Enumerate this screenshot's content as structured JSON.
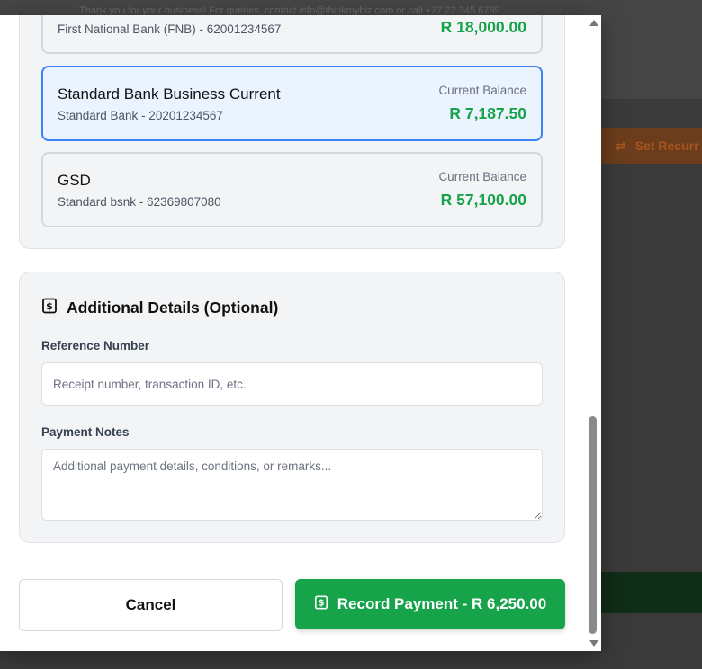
{
  "background": {
    "footer_text": "Thank you for your business! For queries, contact info@thinkmybiz.com or call +27 22 345 6789",
    "recurring_label": "Set Recurr"
  },
  "accounts": [
    {
      "name": "",
      "sub": "First National Bank (FNB) - 62001234567",
      "balance_label": "",
      "balance": "R 18,000.00",
      "selected": false
    },
    {
      "name": "Standard Bank Business Current",
      "sub": "Standard Bank - 20201234567",
      "balance_label": "Current Balance",
      "balance": "R 7,187.50",
      "selected": true
    },
    {
      "name": "GSD",
      "sub": "Standard bsnk - 62369807080",
      "balance_label": "Current Balance",
      "balance": "R 57,100.00",
      "selected": false
    }
  ],
  "details": {
    "title": "Additional Details (Optional)",
    "reference_label": "Reference Number",
    "reference_placeholder": "Receipt number, transaction ID, etc.",
    "reference_value": "",
    "notes_label": "Payment Notes",
    "notes_placeholder": "Additional payment details, conditions, or remarks...",
    "notes_value": ""
  },
  "actions": {
    "cancel_label": "Cancel",
    "record_label": "Record Payment - R 6,250.00"
  },
  "icons": {
    "section_icon": "money-bill-icon",
    "record_icon": "money-bill-icon",
    "recurring_icon": "repeat-icon"
  },
  "colors": {
    "accent_green": "#16a34a",
    "selected_border": "#3b82f6",
    "selected_bg": "#eaf3fe"
  }
}
